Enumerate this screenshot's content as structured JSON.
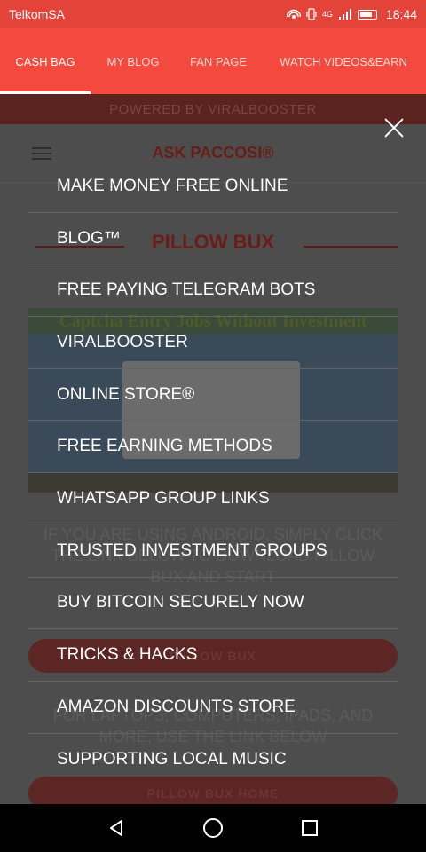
{
  "status_bar": {
    "carrier": "TelkomSA",
    "time": "18:44",
    "signal_text": "4G",
    "icons": [
      "hotspot-icon",
      "vibrate-icon",
      "signal-icon",
      "battery-icon"
    ]
  },
  "tabs": [
    {
      "label": "CASH BAG",
      "active": true
    },
    {
      "label": "MY BLOG",
      "active": false
    },
    {
      "label": "FAN PAGE",
      "active": false
    },
    {
      "label": "WATCH VIDEOS&EARN",
      "active": false
    }
  ],
  "page": {
    "powered_by": "POWERED BY VIRALBOOSTER",
    "site_title": "ASK PACCOSI®",
    "heading": "PILLOW BUX",
    "banner_text": "Captcha Entry Jobs Without Investment",
    "paragraph": "IF YOU ARE USING ANDROID, SIMPLY CLICK THE LINK BELOW TO DOWNLOAD PILLOW BUX AND START",
    "pill_one": "PILLOW BUX",
    "paragraph_two": "FOR LAPTOPS, COMPUTERS, IPADS, AND MORE, USE THE LINK BELOW",
    "pill_two": "PILLOW BUX HOME"
  },
  "menu": {
    "items": [
      "MAKE MONEY FREE ONLINE",
      "BLOG™",
      "FREE PAYING TELEGRAM BOTS",
      "VIRALBOOSTER",
      "ONLINE STORE®",
      "FREE EARNING METHODS",
      "WHATSAPP GROUP LINKS",
      "TRUSTED INVESTMENT GROUPS",
      "BUY BITCOIN SECURELY NOW",
      "TRICKS & HACKS",
      "AMAZON DISCOUNTS STORE",
      "SUPPORTING LOCAL MUSIC"
    ]
  },
  "colors": {
    "accent": "#f4493f",
    "status_bar": "#e4433a",
    "overlay": "#4b4b4b"
  }
}
